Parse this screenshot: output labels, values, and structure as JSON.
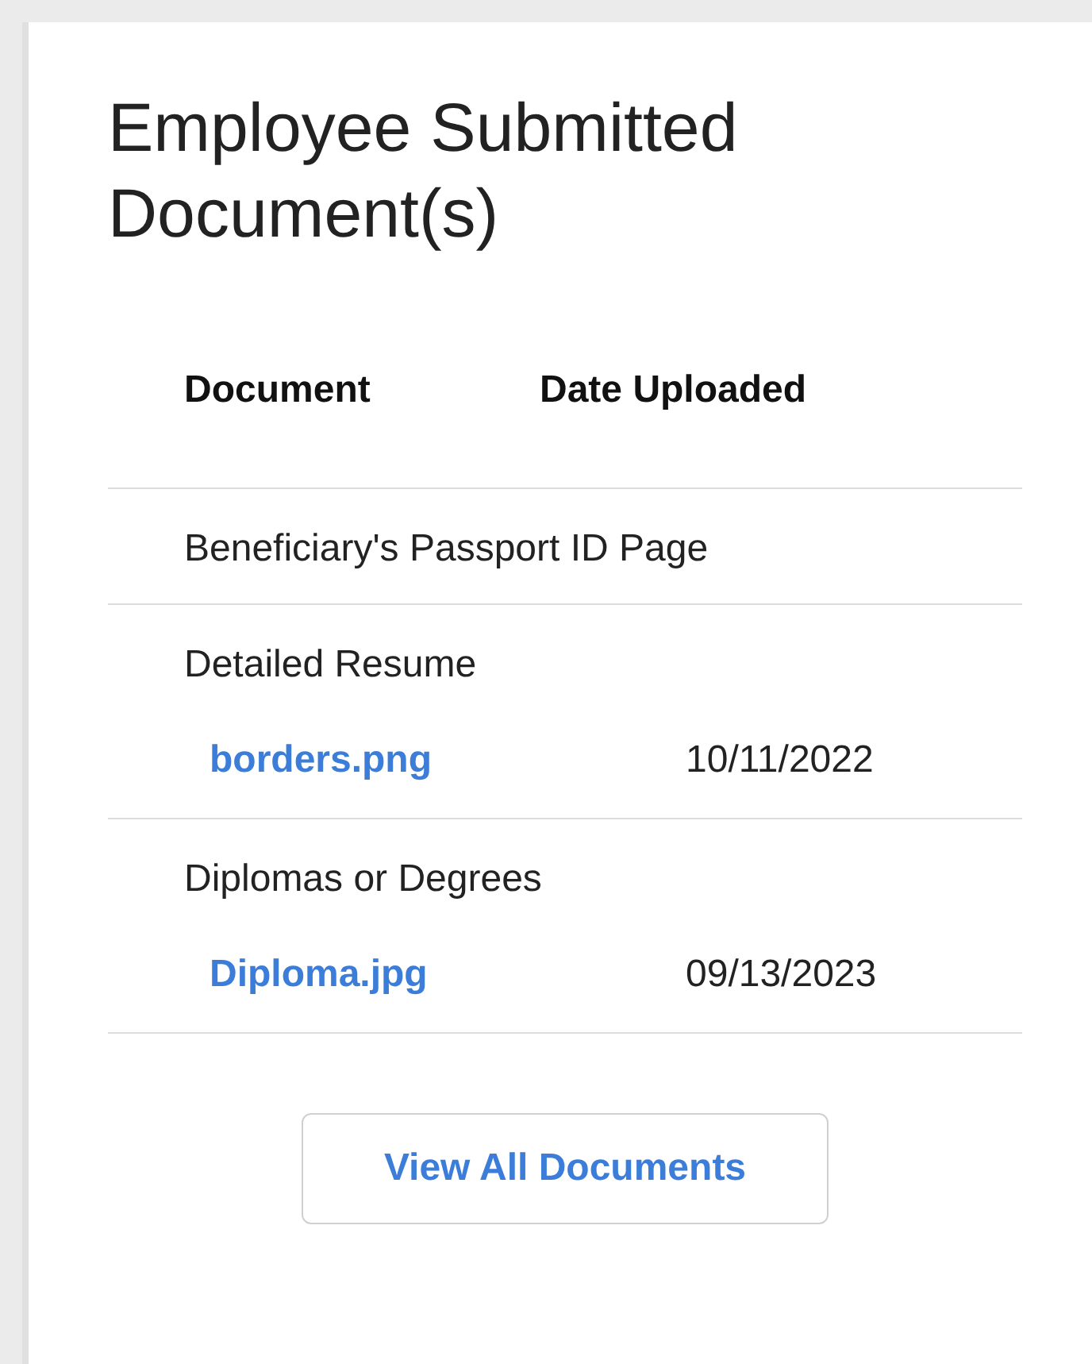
{
  "card": {
    "title": "Employee Submitted Document(s)"
  },
  "table": {
    "columns": [
      "Document",
      "Date Uploaded"
    ],
    "rows": [
      {
        "document": "Beneficiary's Passport ID Page",
        "files": []
      },
      {
        "document": "Detailed Resume",
        "files": [
          {
            "name": "borders.png",
            "date": "10/11/2022"
          }
        ]
      },
      {
        "document": "Diplomas or Degrees",
        "files": [
          {
            "name": "Diploma.jpg",
            "date": "09/13/2023"
          }
        ]
      }
    ]
  },
  "button": "View All Documents"
}
